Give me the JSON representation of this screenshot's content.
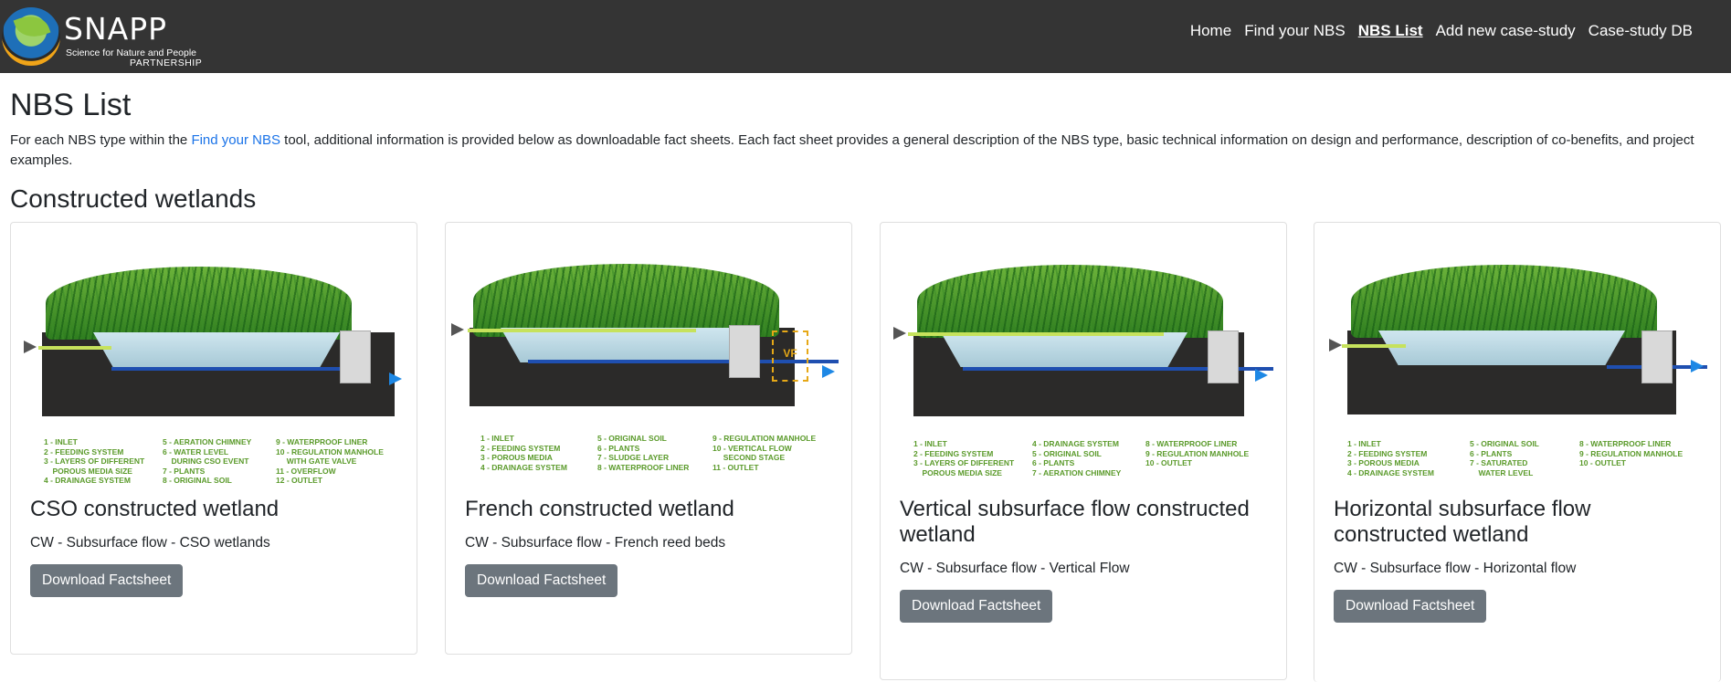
{
  "brand": {
    "name": "SNAPP",
    "tagline": "Science for Nature and People",
    "tagline2": "PARTNERSHIP"
  },
  "nav": {
    "items": [
      {
        "label": "Home",
        "active": false
      },
      {
        "label": "Find your NBS",
        "active": false
      },
      {
        "label": "NBS List",
        "active": true
      },
      {
        "label": "Add new case-study",
        "active": false
      },
      {
        "label": "Case-study DB",
        "active": false
      }
    ]
  },
  "page": {
    "title": "NBS List",
    "intro_before": "For each NBS type within the ",
    "intro_link": "Find your NBS",
    "intro_after": " tool, additional information is provided below as downloadable fact sheets. Each fact sheet provides a general description of the NBS type, basic technical information on design and performance, description of co-benefits, and project examples.",
    "section_title": "Constructed wetlands"
  },
  "colors": {
    "navbar": "#343434",
    "button": "#6c757d",
    "link": "#1a73e8"
  },
  "cards": [
    {
      "title": "CSO constructed wetland",
      "subtitle": "CW - Subsurface flow - CSO wetlands",
      "button": "Download Factsheet",
      "legend": [
        "1 - INLET",
        "2 - FEEDING SYSTEM",
        "3 - LAYERS OF DIFFERENT",
        "    POROUS MEDIA SIZE",
        "4 - DRAINAGE SYSTEM",
        "5 - AERATION CHIMNEY",
        "6 - WATER LEVEL",
        "    DURING CSO EVENT",
        "7 - PLANTS",
        "8 - ORIGINAL SOIL",
        "9 - WATERPROOF LINER",
        "10 - REGULATION MANHOLE",
        "     WITH GATE VALVE",
        "11 - OVERFLOW",
        "12 - OUTLET"
      ]
    },
    {
      "title": "French constructed wetland",
      "subtitle": "CW - Subsurface flow - French reed beds",
      "button": "Download Factsheet",
      "legend": [
        "1 - INLET",
        "2 - FEEDING SYSTEM",
        "3 - POROUS MEDIA",
        "4 - DRAINAGE SYSTEM",
        "5 - ORIGINAL SOIL",
        "6 - PLANTS",
        "7 - SLUDGE LAYER",
        "8 - WATERPROOF LINER",
        "9 - REGULATION MANHOLE",
        "10 - VERTICAL FLOW",
        "     SECOND STAGE",
        "11 - OUTLET"
      ],
      "badge": "VF"
    },
    {
      "title": "Vertical subsurface flow constructed wetland",
      "subtitle": "CW - Subsurface flow - Vertical Flow",
      "button": "Download Factsheet",
      "legend": [
        "1 - INLET",
        "2 - FEEDING SYSTEM",
        "3 - LAYERS OF DIFFERENT",
        "    POROUS MEDIA SIZE",
        "4 - DRAINAGE SYSTEM",
        "5 - ORIGINAL SOIL",
        "6 - PLANTS",
        "7 - AERATION CHIMNEY",
        "8 - WATERPROOF LINER",
        "9 - REGULATION MANHOLE",
        "10 - OUTLET"
      ]
    },
    {
      "title": "Horizontal subsurface flow constructed wetland",
      "subtitle": "CW - Subsurface flow - Horizontal flow",
      "button": "Download Factsheet",
      "legend": [
        "1 - INLET",
        "2 - FEEDING SYSTEM",
        "3 - POROUS MEDIA",
        "4 - DRAINAGE SYSTEM",
        "5 - ORIGINAL SOIL",
        "6 - PLANTS",
        "7 - SATURATED",
        "    WATER LEVEL",
        "8 - WATERPROOF LINER",
        "9 - REGULATION MANHOLE",
        "10 - OUTLET"
      ]
    }
  ]
}
